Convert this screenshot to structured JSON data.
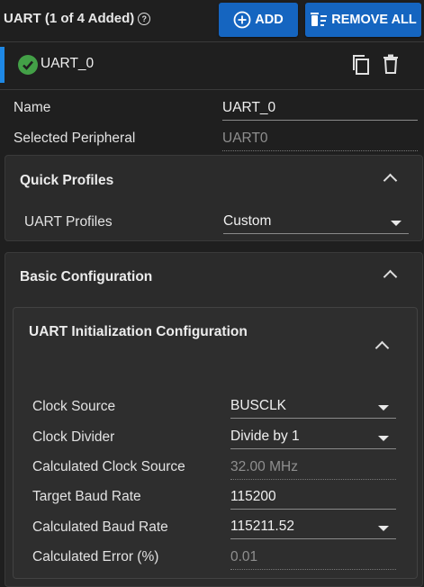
{
  "header": {
    "title": "UART (1 of 4 Added)",
    "help_glyph": "?",
    "add_label": "ADD",
    "remove_all_label": "REMOVE ALL"
  },
  "instance": {
    "name": "UART_0"
  },
  "general": {
    "name_label": "Name",
    "name_value": "UART_0",
    "peripheral_label": "Selected Peripheral",
    "peripheral_value": "UART0"
  },
  "quick_profiles": {
    "title": "Quick Profiles",
    "profiles_label": "UART Profiles",
    "profiles_value": "Custom"
  },
  "basic_config": {
    "title": "Basic Configuration",
    "init_title": "UART Initialization Configuration",
    "fields": [
      {
        "label": "Clock Source",
        "value": "BUSCLK"
      },
      {
        "label": "Clock Divider",
        "value": "Divide by 1"
      },
      {
        "label": "Calculated Clock Source",
        "value": "32.00 MHz"
      },
      {
        "label": "Target Baud Rate",
        "value": "115200"
      },
      {
        "label": "Calculated Baud Rate",
        "value": "115211.52"
      },
      {
        "label": "Calculated Error (%)",
        "value": "0.01"
      }
    ]
  }
}
